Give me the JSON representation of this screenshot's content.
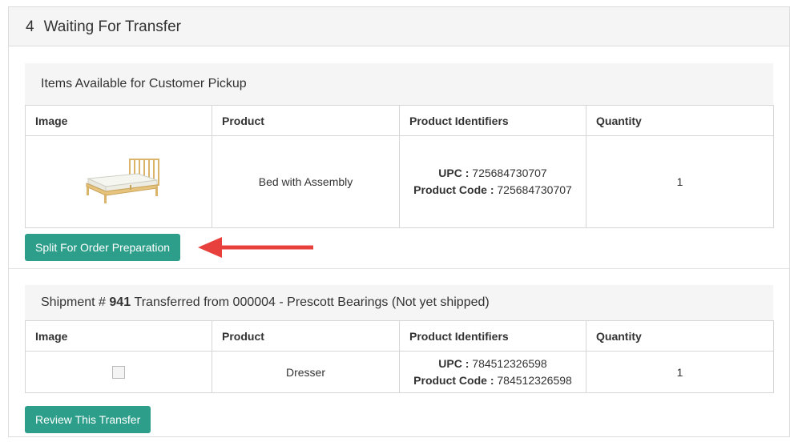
{
  "panel": {
    "step_number": "4",
    "title": "Waiting For Transfer"
  },
  "pickup": {
    "heading": "Items Available for Customer Pickup",
    "columns": [
      "Image",
      "Product",
      "Product Identifiers",
      "Quantity"
    ],
    "row": {
      "image_icon": "bed-product-image",
      "product": "Bed with Assembly",
      "upc_label": "UPC :",
      "upc": "725684730707",
      "code_label": "Product Code :",
      "code": "725684730707",
      "quantity": "1"
    },
    "split_button": "Split For Order Preparation"
  },
  "shipment": {
    "prefix": "Shipment #",
    "number": "941",
    "suffix": "Transferred from 000004 - Prescott Bearings (Not yet shipped)",
    "columns": [
      "Image",
      "Product",
      "Product Identifiers",
      "Quantity"
    ],
    "row": {
      "image_icon": "broken-image-icon",
      "product": "Dresser",
      "upc_label": "UPC :",
      "upc": "784512326598",
      "code_label": "Product Code :",
      "code": "784512326598",
      "quantity": "1"
    },
    "review_button": "Review This Transfer"
  },
  "colors": {
    "button": "#2d9e8a",
    "arrow": "#e8413d",
    "header_bg": "#f5f5f5"
  }
}
